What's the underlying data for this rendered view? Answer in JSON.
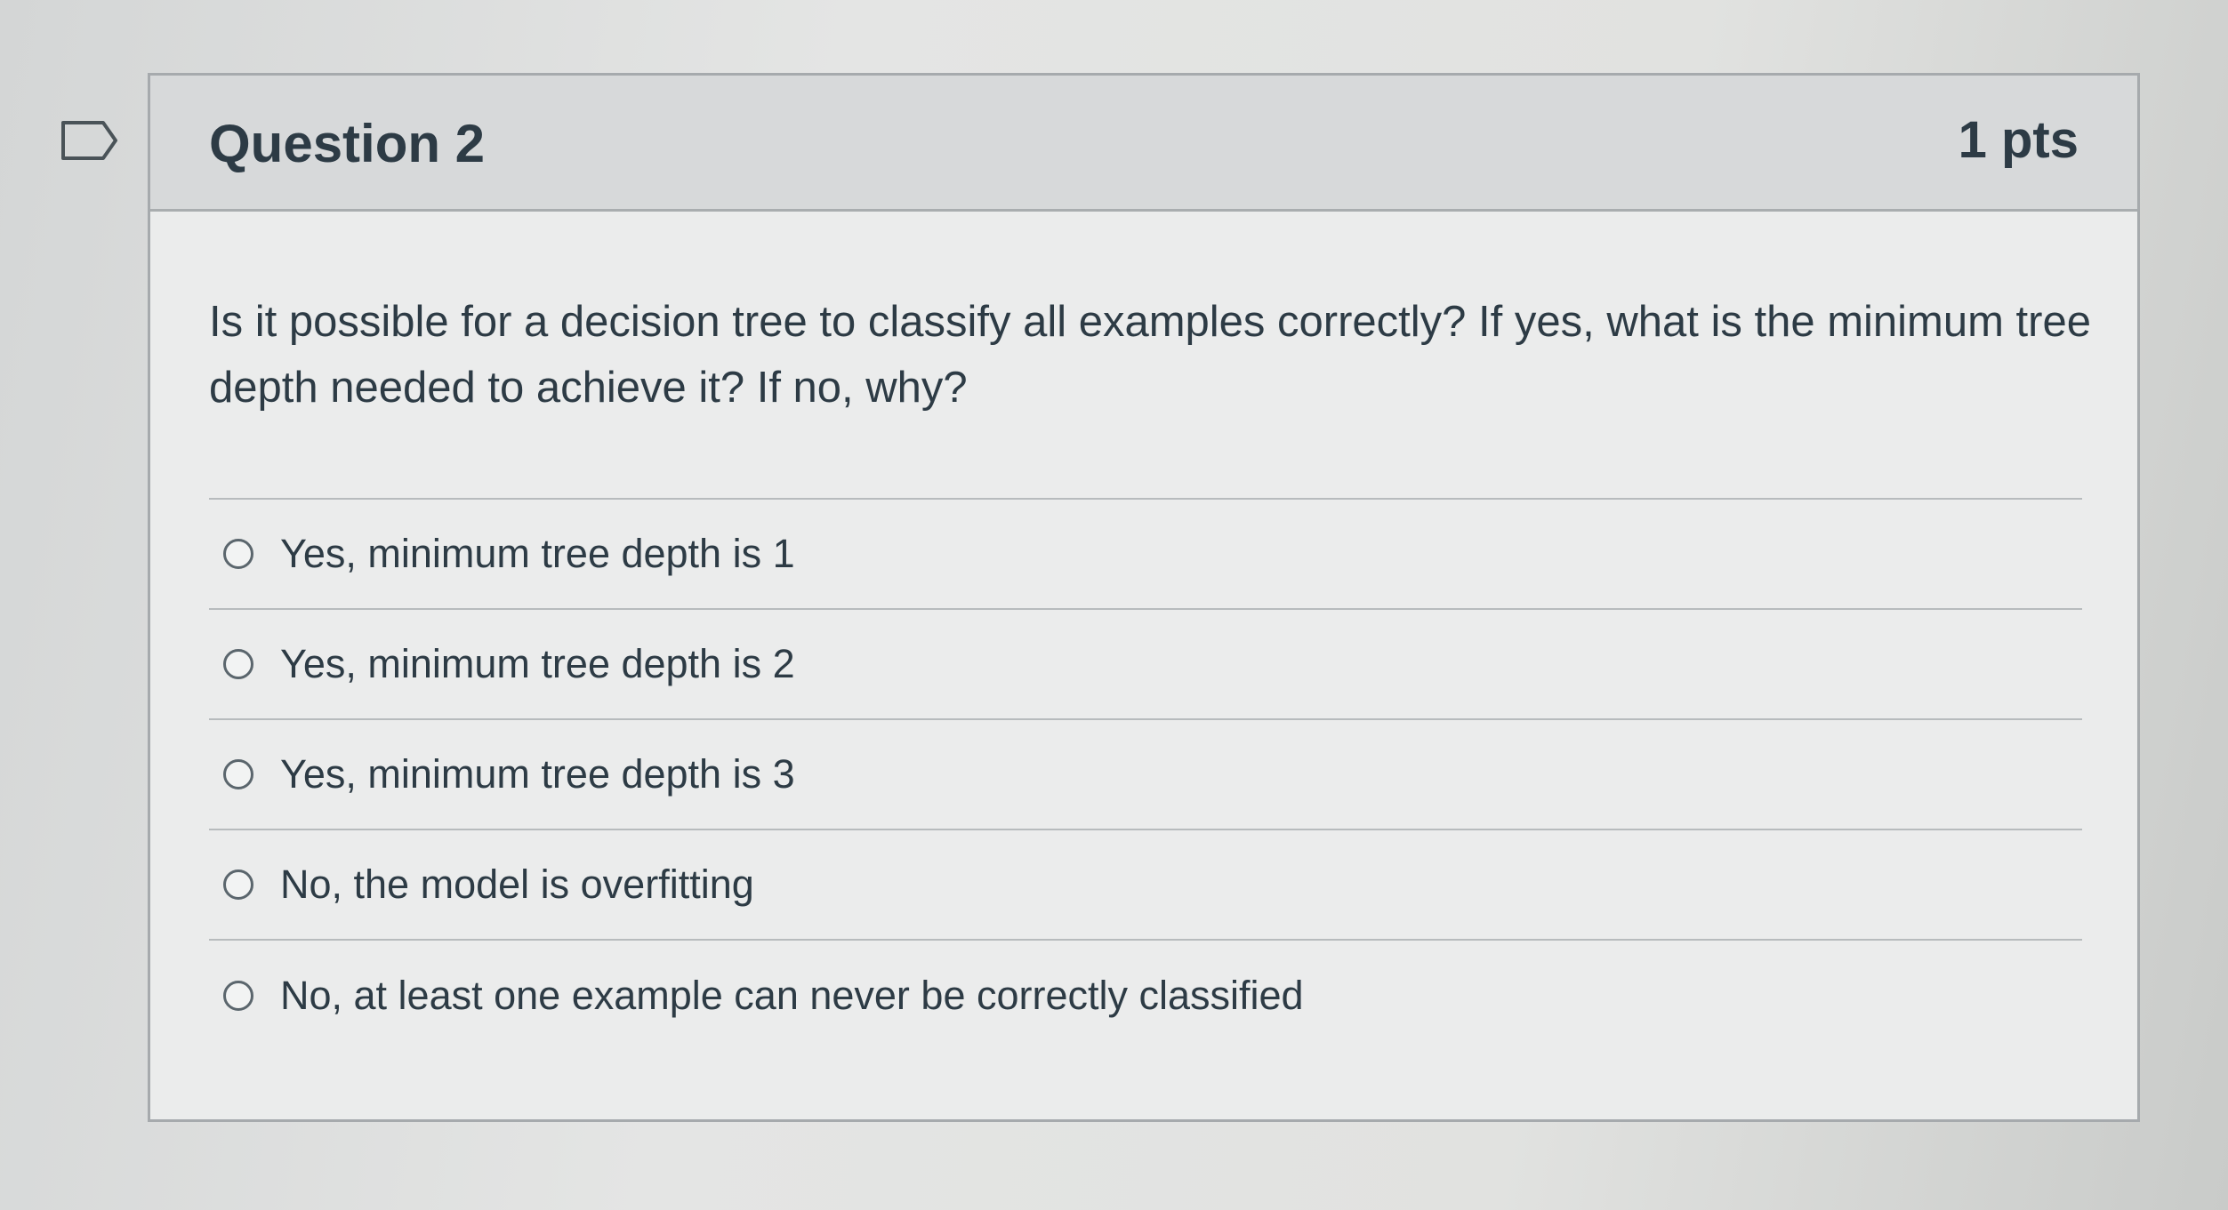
{
  "question": {
    "title": "Question 2",
    "points": "1 pts",
    "text": "Is it possible for a decision tree to classify all examples correctly? If yes, what is the minimum tree depth needed to achieve it? If no, why?",
    "answers": [
      {
        "label": "Yes, minimum tree depth is 1",
        "selected": false
      },
      {
        "label": "Yes, minimum tree depth is 2",
        "selected": false
      },
      {
        "label": "Yes, minimum tree depth is 3",
        "selected": false
      },
      {
        "label": "No, the model is overfitting",
        "selected": false
      },
      {
        "label": "No, at least one example can never be correctly classified",
        "selected": false
      }
    ]
  },
  "icons": {
    "flag": "flag-question-icon"
  },
  "colors": {
    "text": "#2d3b45",
    "header_bg": "#d7d9da",
    "border": "#a6aaad"
  }
}
